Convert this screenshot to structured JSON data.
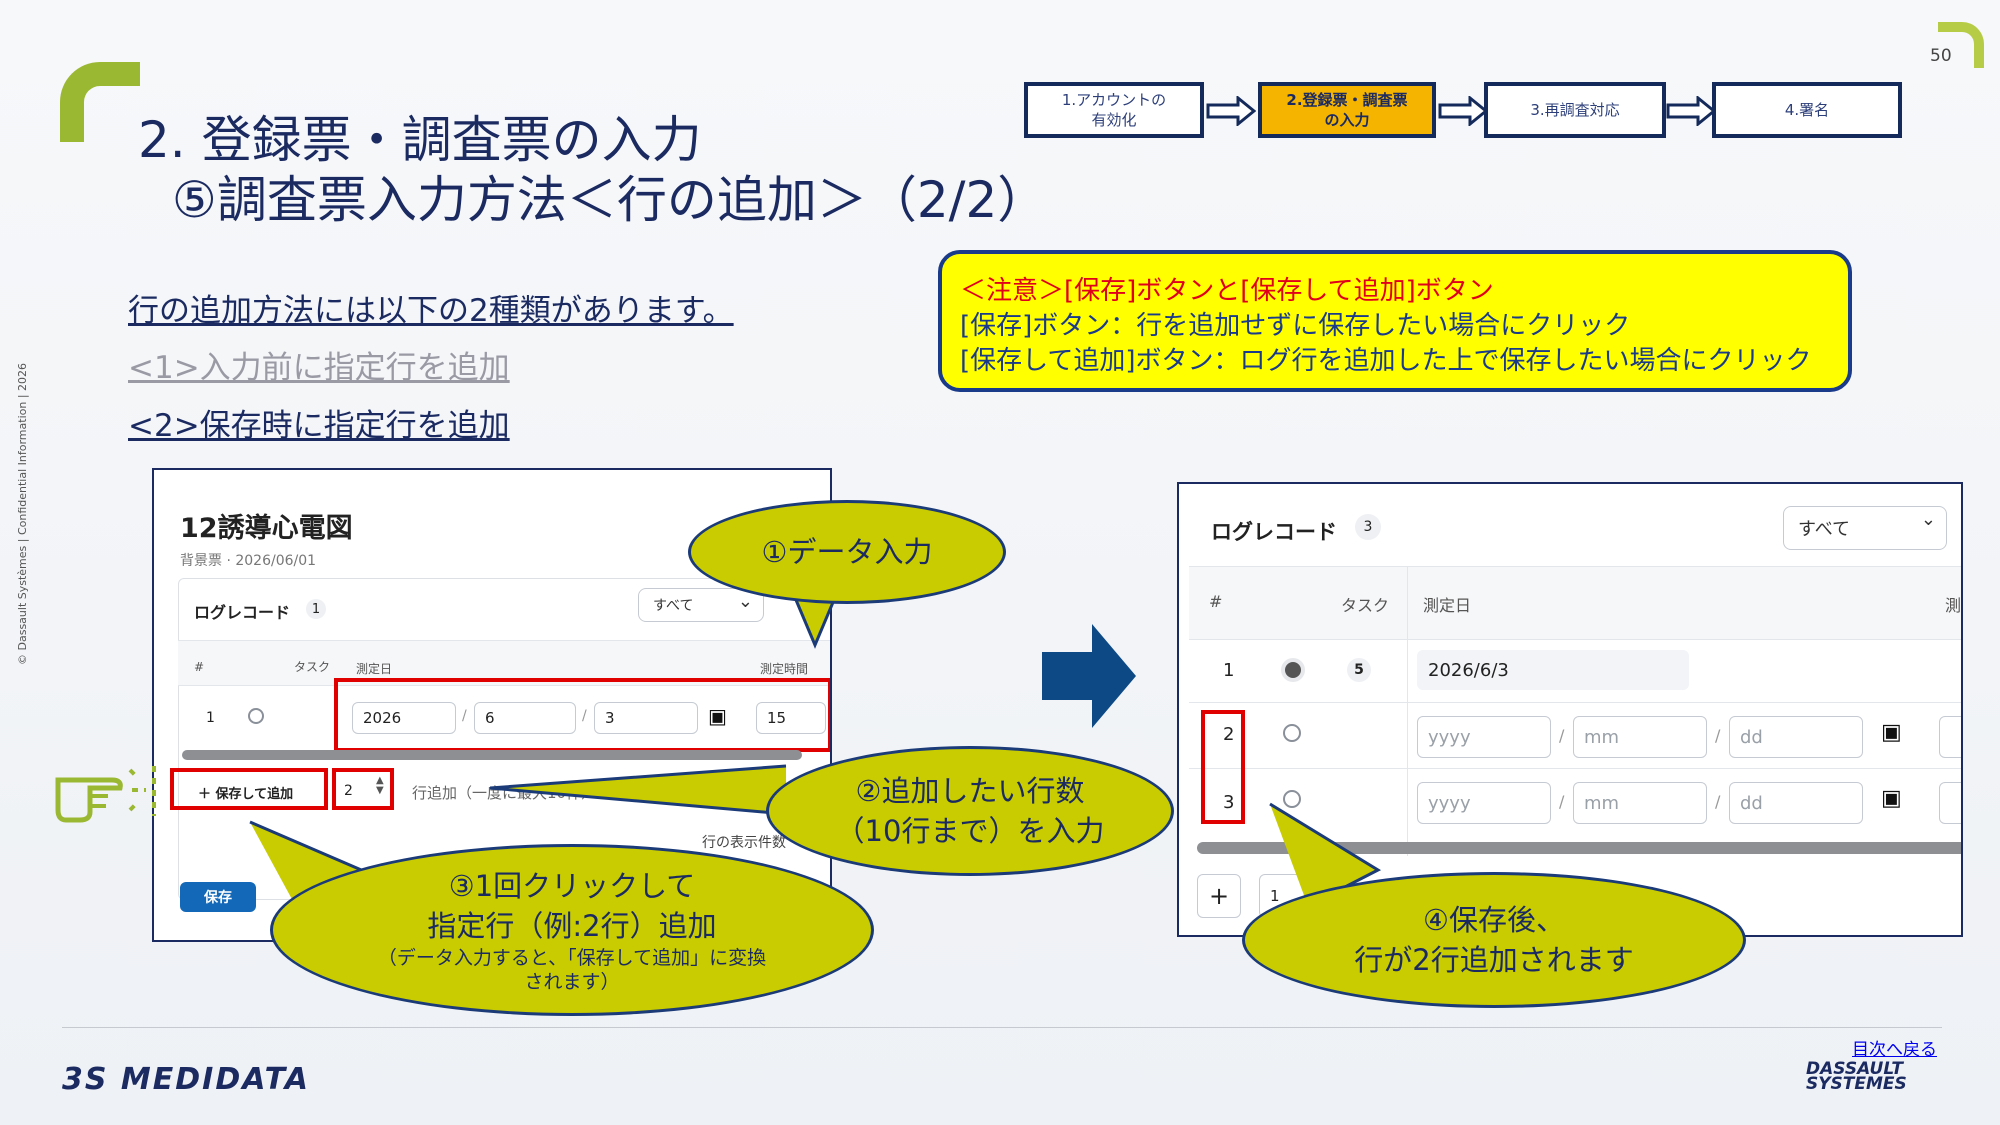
{
  "page_number": "50",
  "title": {
    "line1": "2. 登録票・調査票の入力",
    "line2": "⑤調査票入力方法＜行の追加＞（2/2）"
  },
  "side_text": "© Dassault Systèmes | Confidential Information | 2026",
  "steps": [
    {
      "label": "1.アカウントの\n有効化",
      "active": false
    },
    {
      "label": "2.登録票・調査票\nの入力",
      "active": true
    },
    {
      "label": "3.再調査対応",
      "active": false
    },
    {
      "label": "4.署名",
      "active": false
    }
  ],
  "intro": {
    "heading": "行の追加方法には以下の2種類があります。",
    "option1": "<1>入力前に指定行を追加",
    "option2": "<2>保存時に指定行を追加"
  },
  "notice": {
    "title": "＜注意＞[保存]ボタンと[保存して追加]ボタン",
    "line1": "[保存]ボタン：行を追加せずに保存したい場合にクリック",
    "line2": "[保存して追加]ボタン：ログ行を追加した上で保存したい場合にクリック"
  },
  "left_screenshot": {
    "form_title": "12誘導心電図",
    "form_subtitle": "背景票 · 2026/06/01",
    "log_record_label": "ログレコード",
    "log_count": "1",
    "filter_value": "すべて",
    "col_hash": "#",
    "col_task": "タスク",
    "col_date": "測定日",
    "col_time": "測定時間",
    "row_num": "1",
    "year": "2026",
    "month": "6",
    "day": "3",
    "time": "15",
    "save_add_button": "＋ 保存して追加",
    "row_count_value": "2",
    "row_add_hint": "行追加（一度に最大10件）",
    "display_count_label": "行の表示件数",
    "save_button": "保存"
  },
  "right_screenshot": {
    "log_record_label": "ログレコード",
    "log_count": "3",
    "filter_value": "すべて",
    "col_hash": "#",
    "col_task": "タスク",
    "col_date": "測定日",
    "col_more": "測",
    "rows": [
      {
        "num": "1",
        "task": "5",
        "date": "2026/6/3"
      },
      {
        "num": "2",
        "yyyy": "yyyy",
        "mm": "mm",
        "dd": "dd"
      },
      {
        "num": "3",
        "yyyy": "yyyy",
        "mm": "mm",
        "dd": "dd"
      }
    ],
    "add_button": "+",
    "add_input": "1"
  },
  "callouts": {
    "c1": "①データ入力",
    "c2_line1": "②追加したい行数",
    "c2_line2": "（10行まで）を入力",
    "c3_line1": "③1回クリックして",
    "c3_line2": "指定行（例:2行）追加",
    "c3_small1": "（データ入力すると、「保存して追加」に変換",
    "c3_small2": "されます）",
    "c4_line1": "④保存後、",
    "c4_line2": "行が2行追加されます"
  },
  "footer": {
    "brand": "3S MEDIDATA",
    "toc_link": "目次へ戻る",
    "ds_logo_line1": "DASSAULT",
    "ds_logo_line2": "SYSTEMES"
  },
  "colors": {
    "navy": "#1b2b62",
    "accent_green": "#9bb832",
    "step_active": "#f4b400",
    "notice_bg": "#ffff00",
    "callout": "#c8cc00",
    "highlight_red": "#e00000"
  }
}
